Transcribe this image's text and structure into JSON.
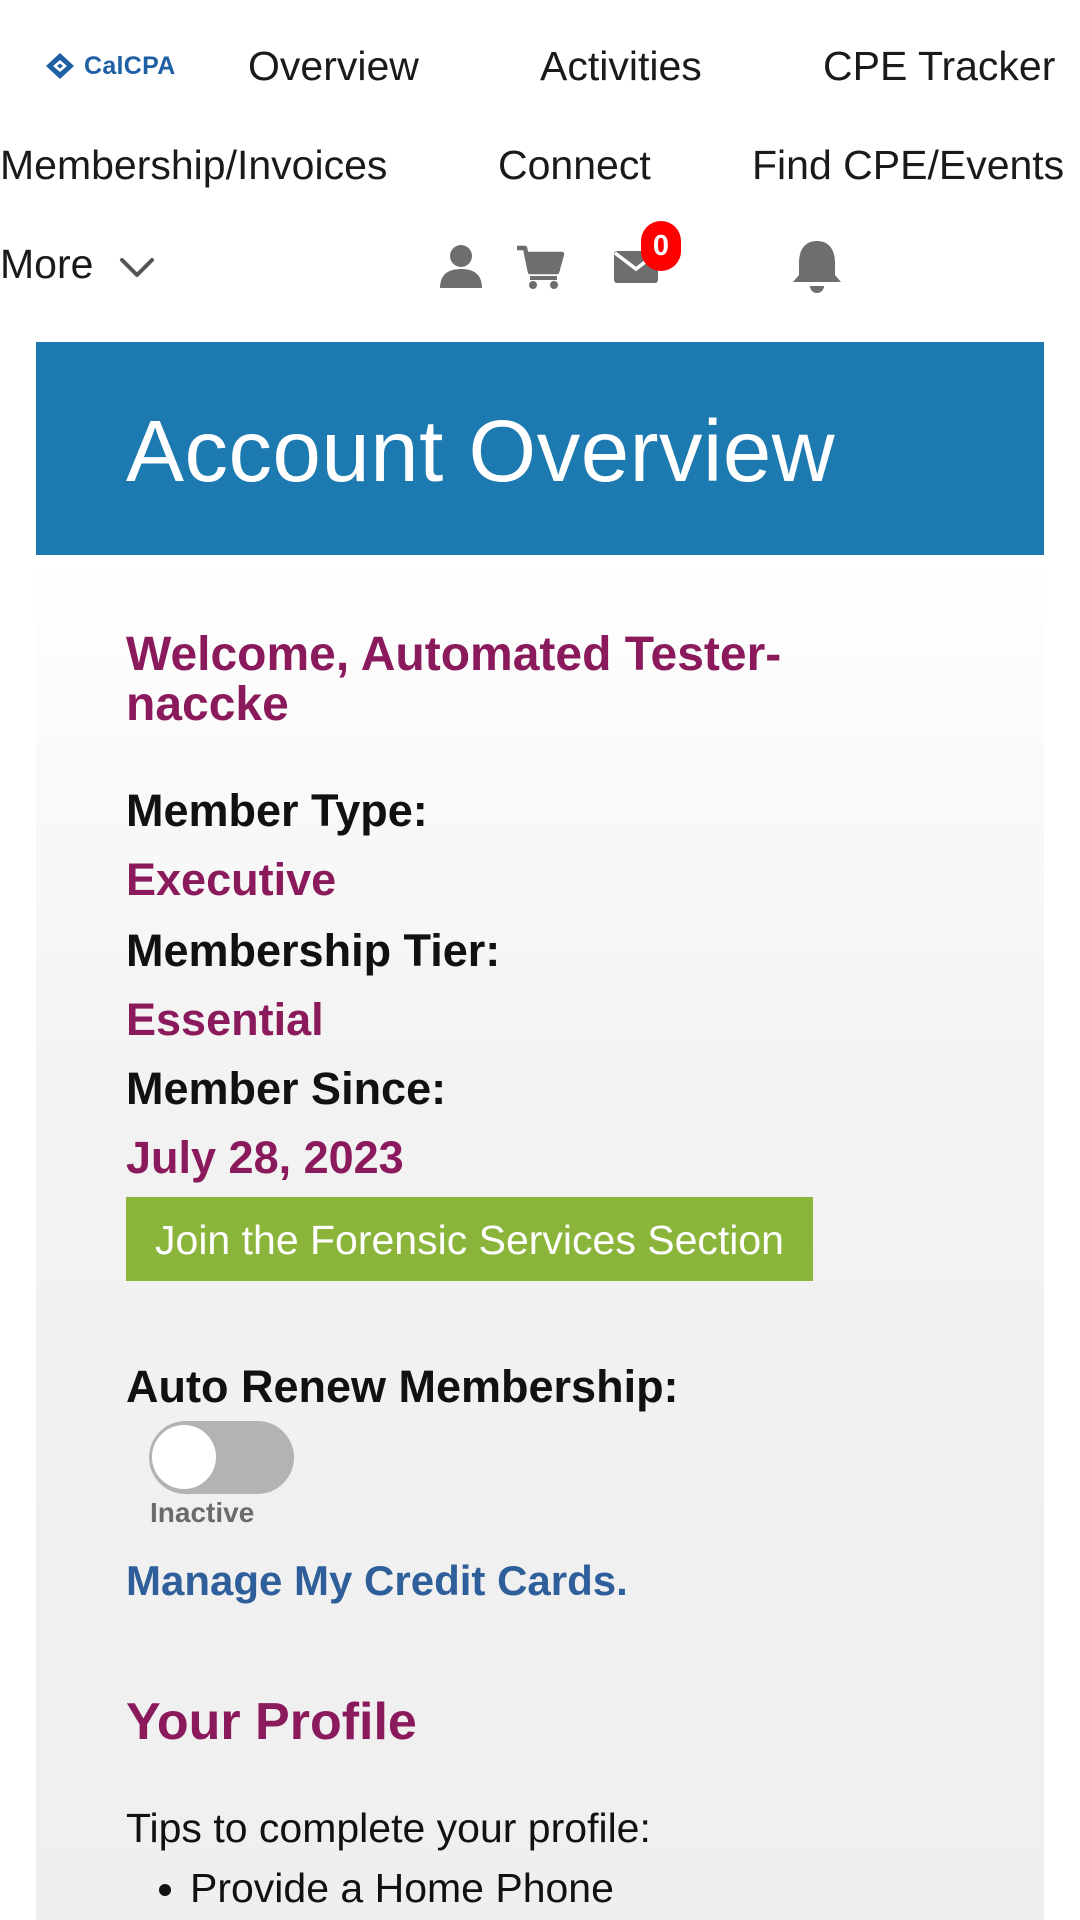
{
  "nav": {
    "logo": {
      "text": "CalCPA",
      "icon": "calcpa-logo-icon",
      "color": "#1f5fa3"
    },
    "row1": [
      "Overview",
      "Activities",
      "CPE Tracker"
    ],
    "row2": [
      "Membership/Invoices",
      "Connect",
      "Find CPE/Events"
    ],
    "more": "More",
    "icons": [
      "user-icon",
      "cart-icon",
      "mail-icon",
      "bell-icon"
    ],
    "mail_badge": "0",
    "badge_color": "#ff0000",
    "icon_color": "#6e6e6e"
  },
  "banner": {
    "title": "Account Overview",
    "background": "#1d7ab0"
  },
  "account": {
    "welcome": "Welcome, Automated Tester-naccke",
    "member_type_label": "Member Type:",
    "member_type_value": "Executive",
    "tier_label": "Membership Tier:",
    "tier_value": "Essential",
    "since_label": "Member Since:",
    "since_value": "July 28, 2023",
    "join_button": "Join the Forensic Services Section",
    "join_button_color": "#8ab43a",
    "auto_renew_label": "Auto Renew Membership:",
    "auto_renew_on": false,
    "auto_renew_status": "Inactive",
    "manage_cards_link": "Manage My Credit Cards.",
    "accent_color": "#8a1a5c",
    "link_color": "#2f5f9a"
  },
  "profile": {
    "title": "Your Profile",
    "tips_intro": "Tips to complete your profile:",
    "tips": [
      "Provide a Home Phone"
    ]
  }
}
